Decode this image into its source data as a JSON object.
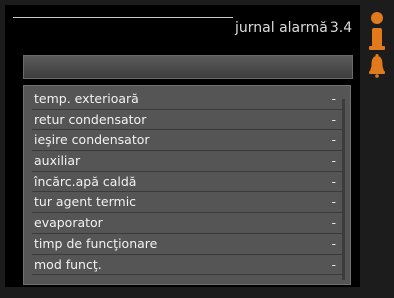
{
  "header": {
    "title": "jurnal alarmă",
    "menu_code": "3.4"
  },
  "list": {
    "rows": [
      {
        "label": "temp. exterioară",
        "value": "-"
      },
      {
        "label": "retur condensator",
        "value": "-"
      },
      {
        "label": "ieşire condensator",
        "value": "-"
      },
      {
        "label": "auxiliar",
        "value": "-"
      },
      {
        "label": "încărc.apă caldă",
        "value": "-"
      },
      {
        "label": "tur agent termic",
        "value": "-"
      },
      {
        "label": "evaporator",
        "value": "-"
      },
      {
        "label": "timp de funcţionare",
        "value": "-"
      },
      {
        "label": "mod funcţ.",
        "value": "-"
      }
    ]
  },
  "colors": {
    "accent": "#e07a1c",
    "panel": "#555555",
    "screen": "#000000"
  },
  "icons": [
    "info-icon",
    "bell-icon"
  ]
}
